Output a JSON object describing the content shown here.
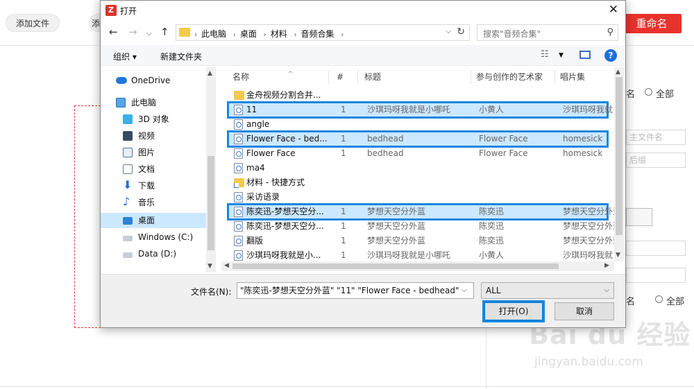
{
  "background": {
    "add_file_label": "添加文件",
    "add_folder_label": "添",
    "rename_label": "重命名",
    "right_panel": {
      "label_name_1": "名",
      "label_all_1": "全部",
      "placeholder_filename": "主文件名",
      "placeholder_suffix": "后缀",
      "label_name_2": "名",
      "label_all_2": "全部"
    },
    "watermark": "Bai du 经验",
    "watermark_url": "jingyan.baidu.com"
  },
  "dialog": {
    "title": "打开",
    "app_icon_letter": "Z",
    "address": [
      "此电脑",
      "桌面",
      "材料",
      "音频合集"
    ],
    "search_placeholder": "搜索\"音频合集\"",
    "commands": {
      "organize": "组织 ▾",
      "new_folder": "新建文件夹"
    },
    "nav_items": [
      {
        "label": "OneDrive",
        "icon": "cloud-icon",
        "indent": 0
      },
      {
        "label": "此电脑",
        "icon": "computer-icon",
        "indent": 0
      },
      {
        "label": "3D 对象",
        "icon": "cube-icon",
        "indent": 1
      },
      {
        "label": "视频",
        "icon": "video-icon",
        "indent": 1
      },
      {
        "label": "图片",
        "icon": "picture-icon",
        "indent": 1
      },
      {
        "label": "文档",
        "icon": "document-icon",
        "indent": 1
      },
      {
        "label": "下载",
        "icon": "download-icon",
        "indent": 1
      },
      {
        "label": "音乐",
        "icon": "music-icon",
        "indent": 1
      },
      {
        "label": "桌面",
        "icon": "desktop-icon",
        "indent": 1,
        "selected": true
      },
      {
        "label": "Windows (C:)",
        "icon": "drive-c-icon",
        "indent": 1
      },
      {
        "label": "Data (D:)",
        "icon": "drive-d-icon",
        "indent": 1
      }
    ],
    "columns": [
      "名称",
      "#",
      "标题",
      "参与创作的艺术家",
      "唱片集"
    ],
    "files": [
      {
        "name": "金舟视频分割合并...",
        "num": "",
        "title": "",
        "artist": "",
        "album": "",
        "type": "folder"
      },
      {
        "name": "11",
        "num": "1",
        "title": "沙琪玛呀我就是小哪吒",
        "artist": "小黄人",
        "album": "沙琪玛呀我就",
        "type": "audio",
        "selected": true,
        "highlighted": true
      },
      {
        "name": "angle",
        "num": "",
        "title": "",
        "artist": "",
        "album": "",
        "type": "audio"
      },
      {
        "name": "Flower Face - bed...",
        "num": "1",
        "title": "bedhead",
        "artist": "Flower Face",
        "album": "homesick",
        "type": "audio",
        "selected": true,
        "highlighted": true
      },
      {
        "name": "Flower Face",
        "num": "1",
        "title": "bedhead",
        "artist": "Flower Face",
        "album": "homesick",
        "type": "audio"
      },
      {
        "name": "ma4",
        "num": "",
        "title": "",
        "artist": "",
        "album": "",
        "type": "audio"
      },
      {
        "name": "材料 - 快捷方式",
        "num": "",
        "title": "",
        "artist": "",
        "album": "",
        "type": "shortcut"
      },
      {
        "name": "采访语录",
        "num": "",
        "title": "",
        "artist": "",
        "album": "",
        "type": "audio"
      },
      {
        "name": "陈奕迅-梦想天空分...",
        "num": "1",
        "title": "梦想天空分外蓝",
        "artist": "陈奕迅",
        "album": "梦想天空分外蓝",
        "type": "audio",
        "selected": true,
        "highlighted": true
      },
      {
        "name": "陈奕迅-梦想天空分...",
        "num": "1",
        "title": "梦想天空分外蓝",
        "artist": "陈奕迅",
        "album": "梦想天空分外蓝",
        "type": "audio"
      },
      {
        "name": "翻版",
        "num": "1",
        "title": "梦想天空分外蓝",
        "artist": "陈奕迅",
        "album": "梦想天空分外蓝",
        "type": "audio"
      },
      {
        "name": "沙琪玛呀我就是小...",
        "num": "1",
        "title": "沙琪玛呀我就是小哪吒",
        "artist": "小黄人",
        "album": "沙琪玛呀我就",
        "type": "audio"
      }
    ],
    "filename_label": "文件名(N):",
    "filename_value": "\"陈奕迅-梦想天空分外蓝\" \"11\" \"Flower Face - bedhead\"",
    "filetype_value": "ALL",
    "open_label": "打开(O)",
    "cancel_label": "取消",
    "colors": {
      "highlight_outline": "#1a87de",
      "selection": "#cce8ff",
      "brand_red": "#e8332c"
    }
  }
}
